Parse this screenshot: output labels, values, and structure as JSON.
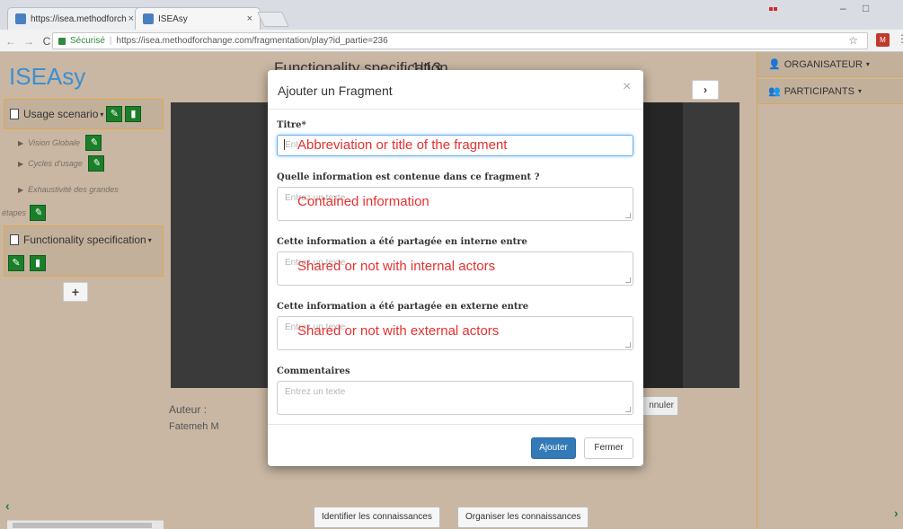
{
  "browser": {
    "tabs": [
      {
        "title": "https://isea.methodforch",
        "close": "×"
      },
      {
        "title": "ISEAsy",
        "close": "×"
      }
    ],
    "secure_label": "Sécurisé",
    "url": "https://isea.methodforchange.com/fragmentation/play?id_partie=236",
    "ext_label": "M"
  },
  "sidebar": {
    "brand": "ISEAsy",
    "sections": [
      {
        "title": "Usage scenario",
        "items": [
          "Vision Globale",
          "Cycles d'usage",
          "Exhaustivité des grandes",
          "étapes"
        ]
      },
      {
        "title": "Functionality specification"
      }
    ],
    "add_label": "+"
  },
  "main": {
    "title": "Functionality specification",
    "count": "1|13",
    "author_label": "Auteur :",
    "author_value": "Fatemeh M",
    "annuler_label": "nnuler",
    "bottom_buttons": [
      "Identifier les connaissances",
      "Organiser les connaissances"
    ]
  },
  "right_panel": {
    "organisateur": "ORGANISATEUR",
    "participants": "PARTICIPANTS"
  },
  "modal": {
    "title": "Ajouter un Fragment",
    "close": "×",
    "fields": [
      {
        "label": "Titre*",
        "placeholder": "Entrez un titre",
        "annotation": "Abbreviation or title of the fragment"
      },
      {
        "label": "Quelle information est contenue dans ce fragment ?",
        "placeholder": "Entrez un texte",
        "annotation": "Contained information"
      },
      {
        "label": "Cette information a été partagée en interne entre",
        "placeholder": "Entrez un texte",
        "annotation": "Shared or not with internal actors"
      },
      {
        "label": "Cette information a été partagée en externe entre",
        "placeholder": "Entrez un texte",
        "annotation": "Shared or not with external actors"
      },
      {
        "label": "Commentaires",
        "placeholder": "Entrez un texte",
        "annotation": ""
      }
    ],
    "submit_label": "Ajouter",
    "close_label": "Fermer"
  },
  "colors": {
    "accent": "#337ab7",
    "green": "#1b7f2a",
    "annotation": "#e53030",
    "background": "#c9b7a3"
  }
}
